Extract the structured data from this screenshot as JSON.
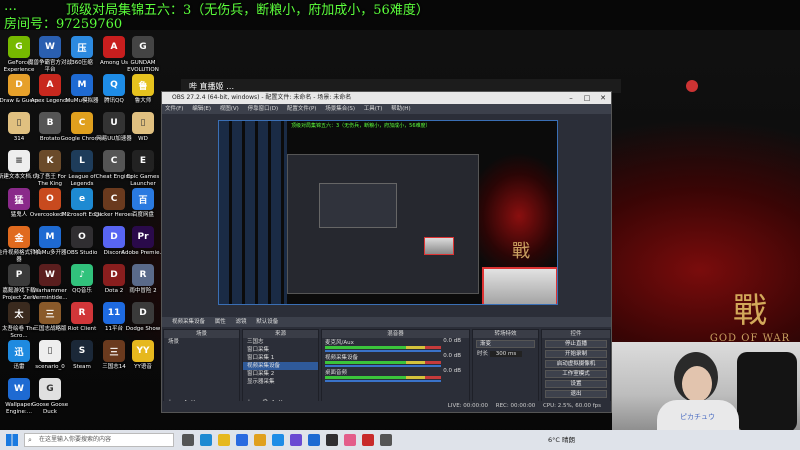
{
  "overlay": {
    "line1_left": "…",
    "line1_right": "顶级对局集锦五六：3（无伤兵，断粮小，府加成小，56难度）",
    "line2": "房间号：97259760"
  },
  "desktop_icons": [
    {
      "label": "GeForce Experience",
      "color": "#76b900",
      "glyph": "G"
    },
    {
      "label": "魔兽争霸官方对战平台",
      "color": "#2a5fb0",
      "glyph": "W"
    },
    {
      "label": "360压缩",
      "color": "#2c8ae0",
      "glyph": "压"
    },
    {
      "label": "Among Us",
      "color": "#c81e1e",
      "glyph": "A"
    },
    {
      "label": "GUNDAM EVOLUTION",
      "color": "#444",
      "glyph": "G"
    },
    {
      "label": "Draw & Guess",
      "color": "#e6a02a",
      "glyph": "D"
    },
    {
      "label": "Apex Legends",
      "color": "#c8281e",
      "glyph": "A"
    },
    {
      "label": "MuMu模拟器",
      "color": "#1e6ad2",
      "glyph": "M"
    },
    {
      "label": "腾讯QQ",
      "color": "#1e8ce6",
      "glyph": "Q"
    },
    {
      "label": "鲁大师",
      "color": "#e6c21e",
      "glyph": "鲁"
    },
    {
      "label": "314",
      "color": "#e0c080",
      "glyph": "▯"
    },
    {
      "label": "Brotato",
      "color": "#555",
      "glyph": "B"
    },
    {
      "label": "Google Chrome",
      "color": "#e0a01e",
      "glyph": "C"
    },
    {
      "label": "网易UU加速器",
      "color": "#333",
      "glyph": "U"
    },
    {
      "label": "WD",
      "color": "#e0c080",
      "glyph": "▯"
    },
    {
      "label": "新建文本文档.txt",
      "color": "#eee",
      "glyph": "≡"
    },
    {
      "label": "为了吾王 For The King",
      "color": "#6a4a2a",
      "glyph": "K"
    },
    {
      "label": "League of Legends",
      "color": "#1e3c5a",
      "glyph": "L"
    },
    {
      "label": "Cheat Engine",
      "color": "#555",
      "glyph": "C"
    },
    {
      "label": "Epic Games Launcher",
      "color": "#222",
      "glyph": "E"
    },
    {
      "label": "猛鬼人",
      "color": "#8a2a8a",
      "glyph": "猛"
    },
    {
      "label": "Overcooked! 2",
      "color": "#c84a1e",
      "glyph": "O"
    },
    {
      "label": "Microsoft Edge",
      "color": "#1e8ad2",
      "glyph": "e"
    },
    {
      "label": "Clicker Heroes",
      "color": "#6a3a1e",
      "glyph": "C"
    },
    {
      "label": "百度网盘",
      "color": "#2a7ae0",
      "glyph": "百"
    },
    {
      "label": "金舟视频格式转换器",
      "color": "#e06a1e",
      "glyph": "金"
    },
    {
      "label": "MuMu多开器",
      "color": "#1e6ad2",
      "glyph": "M"
    },
    {
      "label": "OBS Studio",
      "color": "#302e31",
      "glyph": "O"
    },
    {
      "label": "Discord",
      "color": "#5865f2",
      "glyph": "D"
    },
    {
      "label": "Adobe Premie...",
      "color": "#2a0a4a",
      "glyph": "Pr"
    },
    {
      "label": "嘉懿游戏下载 Project Zero",
      "color": "#3a3a3a",
      "glyph": "P"
    },
    {
      "label": "Warhammer Vermintide...",
      "color": "#5a1e1e",
      "glyph": "W"
    },
    {
      "label": "QQ音乐",
      "color": "#31c27c",
      "glyph": "♪"
    },
    {
      "label": "Dota 2",
      "color": "#8a1e1e",
      "glyph": "D"
    },
    {
      "label": "雨中冒险 2",
      "color": "#5a6a8a",
      "glyph": "R"
    },
    {
      "label": "太吾绘卷 The Scro...",
      "color": "#3a2a1e",
      "glyph": "太"
    },
    {
      "label": "三国志战略版",
      "color": "#8a5a2a",
      "glyph": "三"
    },
    {
      "label": "Riot Client",
      "color": "#d13639",
      "glyph": "R"
    },
    {
      "label": "11平台",
      "color": "#1e6ae0",
      "glyph": "11"
    },
    {
      "label": "Dodge Show",
      "color": "#3a3a3a",
      "glyph": "D"
    },
    {
      "label": "迅雷",
      "color": "#1e8ae0",
      "glyph": "迅"
    },
    {
      "label": "scenario_0",
      "color": "#eee",
      "glyph": "▯"
    },
    {
      "label": "Steam",
      "color": "#1b2838",
      "glyph": "S"
    },
    {
      "label": "三国志14",
      "color": "#6a3a1e",
      "glyph": "三"
    },
    {
      "label": "YY语音",
      "color": "#e6b81e",
      "glyph": "YY"
    },
    {
      "label": "Wallpaper Engine:...",
      "color": "#1e6ad2",
      "glyph": "W"
    },
    {
      "label": "Goose Goose Duck",
      "color": "#e0e0e0",
      "glyph": "G"
    }
  ],
  "bilibili": {
    "title": "哔 直播姬 …"
  },
  "obs": {
    "title": "OBS 27.2.4 (64-bit, windows) - 配置文件: 未命名 - 场景: 未命名",
    "menu": [
      "文件(F)",
      "编辑(E)",
      "视图(V)",
      "停靠窗口(D)",
      "配置文件(P)",
      "场景集合(S)",
      "工具(T)",
      "帮助(H)"
    ],
    "preview_text": "顶级对局集锦五六：3（无伤兵，断粮小，府加成小，56难度）",
    "preview_zhan": "戰",
    "source_toolbar": [
      "视频采集设备",
      "属性",
      "滤镜",
      "默认设备"
    ],
    "scenes": {
      "header": "场景",
      "items": [
        "场景"
      ]
    },
    "sources": {
      "header": "来源",
      "items": [
        "三国志",
        "窗口采集",
        "窗口采集 1",
        "视频采集设备",
        "窗口采集 2",
        "显示器采集"
      ]
    },
    "mixer": {
      "header": "混音器",
      "tracks": [
        {
          "name": "麦克风/Aux",
          "level": "0.0 dB"
        },
        {
          "name": "视频采集设备",
          "level": "0.0 dB"
        },
        {
          "name": "桌面音频",
          "level": "0.0 dB"
        }
      ]
    },
    "transitions": {
      "header": "转场特效",
      "type": "渐变",
      "duration_label": "时长",
      "duration": "300 ms"
    },
    "controls": {
      "header": "控件",
      "buttons": [
        "停止直播",
        "开始录制",
        "启动虚拟摄像机",
        "工作室模式",
        "设置",
        "退出"
      ]
    },
    "status": {
      "live": "LIVE: 00:00:00",
      "rec": "REC: 00:00:00",
      "cpu": "CPU: 2.5%, 60.00 fps"
    }
  },
  "wallpaper": {
    "zhan": "戰",
    "god_of_war": "GOD OF WAR"
  },
  "webcam": {
    "shirt_text": "ピカチュウ"
  },
  "taskbar": {
    "search_placeholder": "在这里输入你要搜索的内容",
    "weather": "6°C 晴朗",
    "icons": [
      {
        "name": "task-view-icon",
        "color": "#555"
      },
      {
        "name": "edge-icon",
        "color": "#1e8ad2"
      },
      {
        "name": "explorer-icon",
        "color": "#e6b81e"
      },
      {
        "name": "store-icon",
        "color": "#2a6ae0"
      },
      {
        "name": "chrome-icon",
        "color": "#e0a01e"
      },
      {
        "name": "qq-icon",
        "color": "#1e8ce6"
      },
      {
        "name": "app-icon-1",
        "color": "#6a4ad2"
      },
      {
        "name": "app-icon-2",
        "color": "#1e6ad2"
      },
      {
        "name": "obs-icon",
        "color": "#302e31"
      },
      {
        "name": "bilibili-icon",
        "color": "#e35d8a"
      },
      {
        "name": "app-icon-3",
        "color": "#c82a2a"
      },
      {
        "name": "app-icon-4",
        "color": "#555"
      }
    ]
  }
}
